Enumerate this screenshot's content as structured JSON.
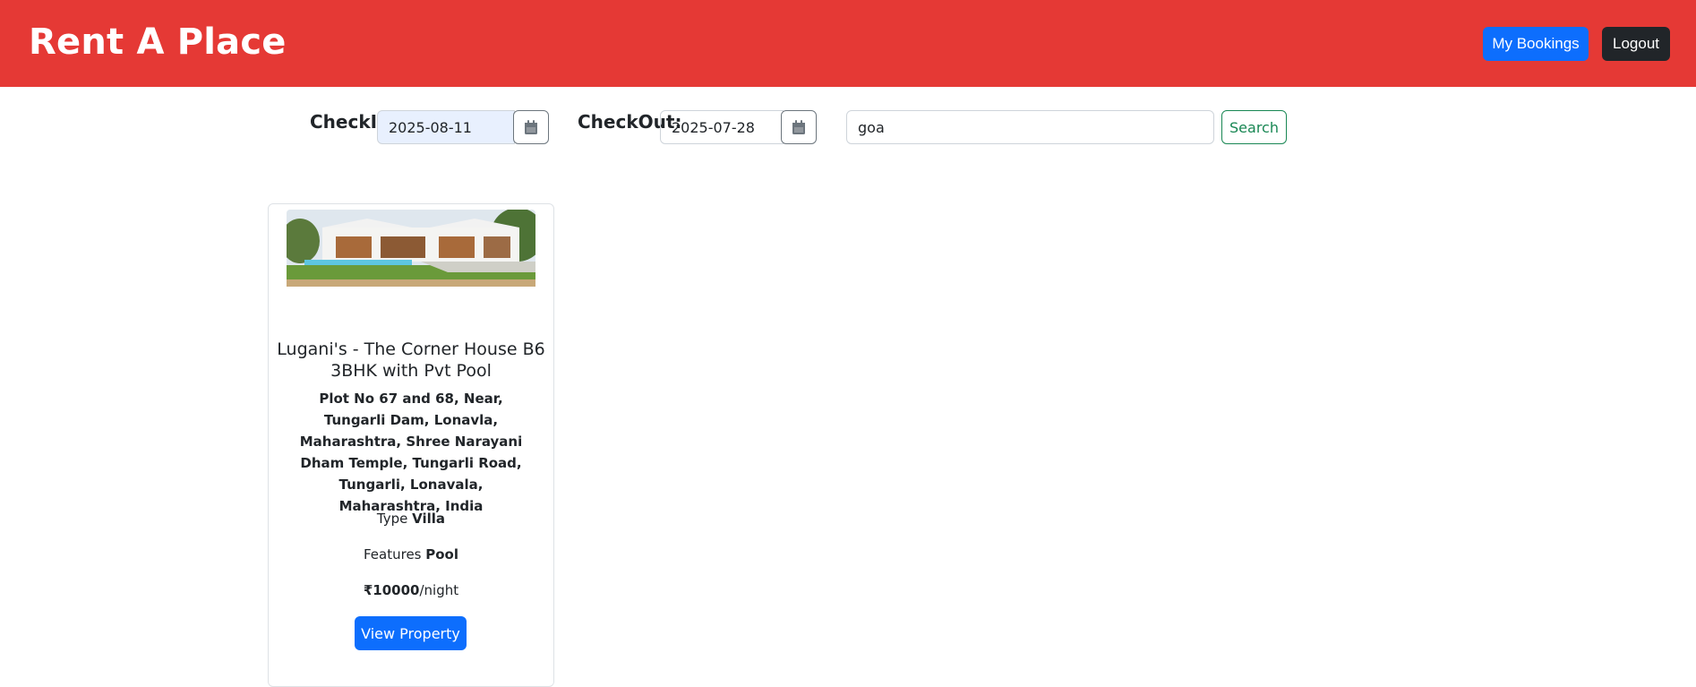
{
  "app": {
    "title": "Rent A Place"
  },
  "header": {
    "my_bookings_label": "My Bookings",
    "logout_label": "Logout"
  },
  "search": {
    "checkin_label": "CheckIn:",
    "checkin_value": "2025-08-11",
    "checkout_label": "CheckOut:",
    "checkout_value": "2025-07-28",
    "query_value": "goa",
    "search_label": "Search"
  },
  "listings": [
    {
      "title": "Lugani's - The Corner House B6 3BHK with Pvt Pool",
      "address": "Plot No 67 and 68, Near, Tungarli Dam, Lonavla, Maharashtra, Shree Narayani Dham Temple, Tungarli Road, Tungarli, Lonavala, Maharashtra, India",
      "type_label": "Type",
      "type_value": "Villa",
      "features_label": "Features",
      "features_value": "Pool",
      "price": "₹10000",
      "price_unit": "/night",
      "view_label": "View Property"
    }
  ],
  "colors": {
    "header_bg": "#e53935",
    "primary": "#0d6efd",
    "dark": "#212529",
    "success": "#198754"
  },
  "icons": {
    "calendar": "calendar-icon"
  }
}
